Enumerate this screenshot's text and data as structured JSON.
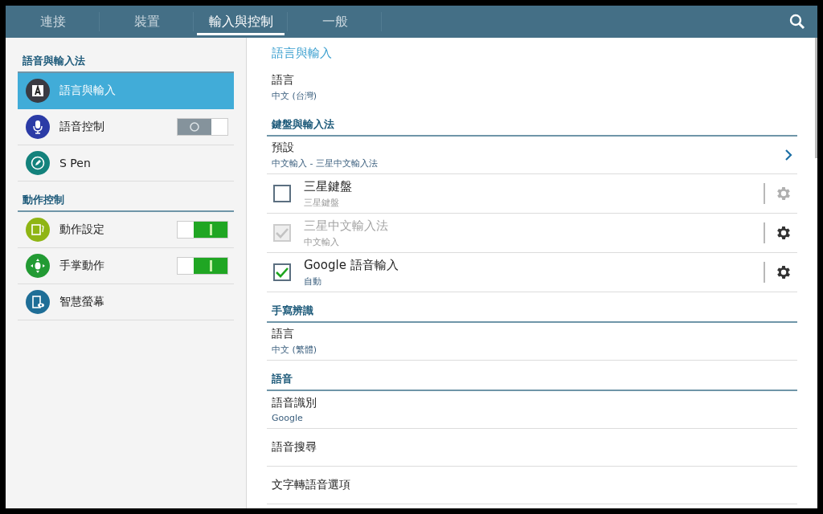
{
  "tabs": [
    {
      "label": "連接",
      "selected": false
    },
    {
      "label": "裝置",
      "selected": false
    },
    {
      "label": "輸入與控制",
      "selected": true
    },
    {
      "label": "一般",
      "selected": false
    }
  ],
  "sidebar": {
    "sections": [
      {
        "title": "語音與輸入法",
        "items": [
          {
            "label": "語言與輸入",
            "color": "#3a3a42",
            "selected": true,
            "kind": "plain"
          },
          {
            "label": "語音控制",
            "color": "#2b3ba6",
            "selected": false,
            "kind": "toggle",
            "on": false
          },
          {
            "label": "S Pen",
            "color": "#13827c",
            "selected": false,
            "kind": "plain"
          }
        ]
      },
      {
        "title": "動作控制",
        "items": [
          {
            "label": "動作設定",
            "color": "#8fb514",
            "selected": false,
            "kind": "toggle",
            "on": true
          },
          {
            "label": "手掌動作",
            "color": "#229a33",
            "selected": false,
            "kind": "toggle",
            "on": true
          },
          {
            "label": "智慧螢幕",
            "color": "#1f6e97",
            "selected": false,
            "kind": "plain"
          }
        ]
      }
    ]
  },
  "content": {
    "title": "語言與輸入",
    "sections": [
      {
        "items": [
          {
            "kind": "setting",
            "title": "語言",
            "value": "中文 (台灣)"
          }
        ]
      },
      {
        "title": "鍵盤與輸入法",
        "items": [
          {
            "kind": "nav",
            "title": "預設",
            "value": "中文輸入 - 三星中文輸入法"
          },
          {
            "kind": "ime",
            "title": "三星鍵盤",
            "value": "三星鍵盤",
            "checked": false,
            "disabled": false
          },
          {
            "kind": "ime",
            "title": "三星中文輸入法",
            "value": "中文輸入",
            "checked": true,
            "disabled": true
          },
          {
            "kind": "ime",
            "title": "Google 語音輸入",
            "value": "自動",
            "checked": true,
            "disabled": false
          }
        ]
      },
      {
        "title": "手寫辨識",
        "items": [
          {
            "kind": "setting",
            "title": "語言",
            "value": "中文 (繁體)"
          }
        ]
      },
      {
        "title": "語音",
        "items": [
          {
            "kind": "setting",
            "title": "語音識別",
            "value": "Google"
          },
          {
            "kind": "setting",
            "title": "語音搜尋"
          },
          {
            "kind": "setting",
            "title": "文字轉語音選項"
          }
        ]
      }
    ]
  }
}
